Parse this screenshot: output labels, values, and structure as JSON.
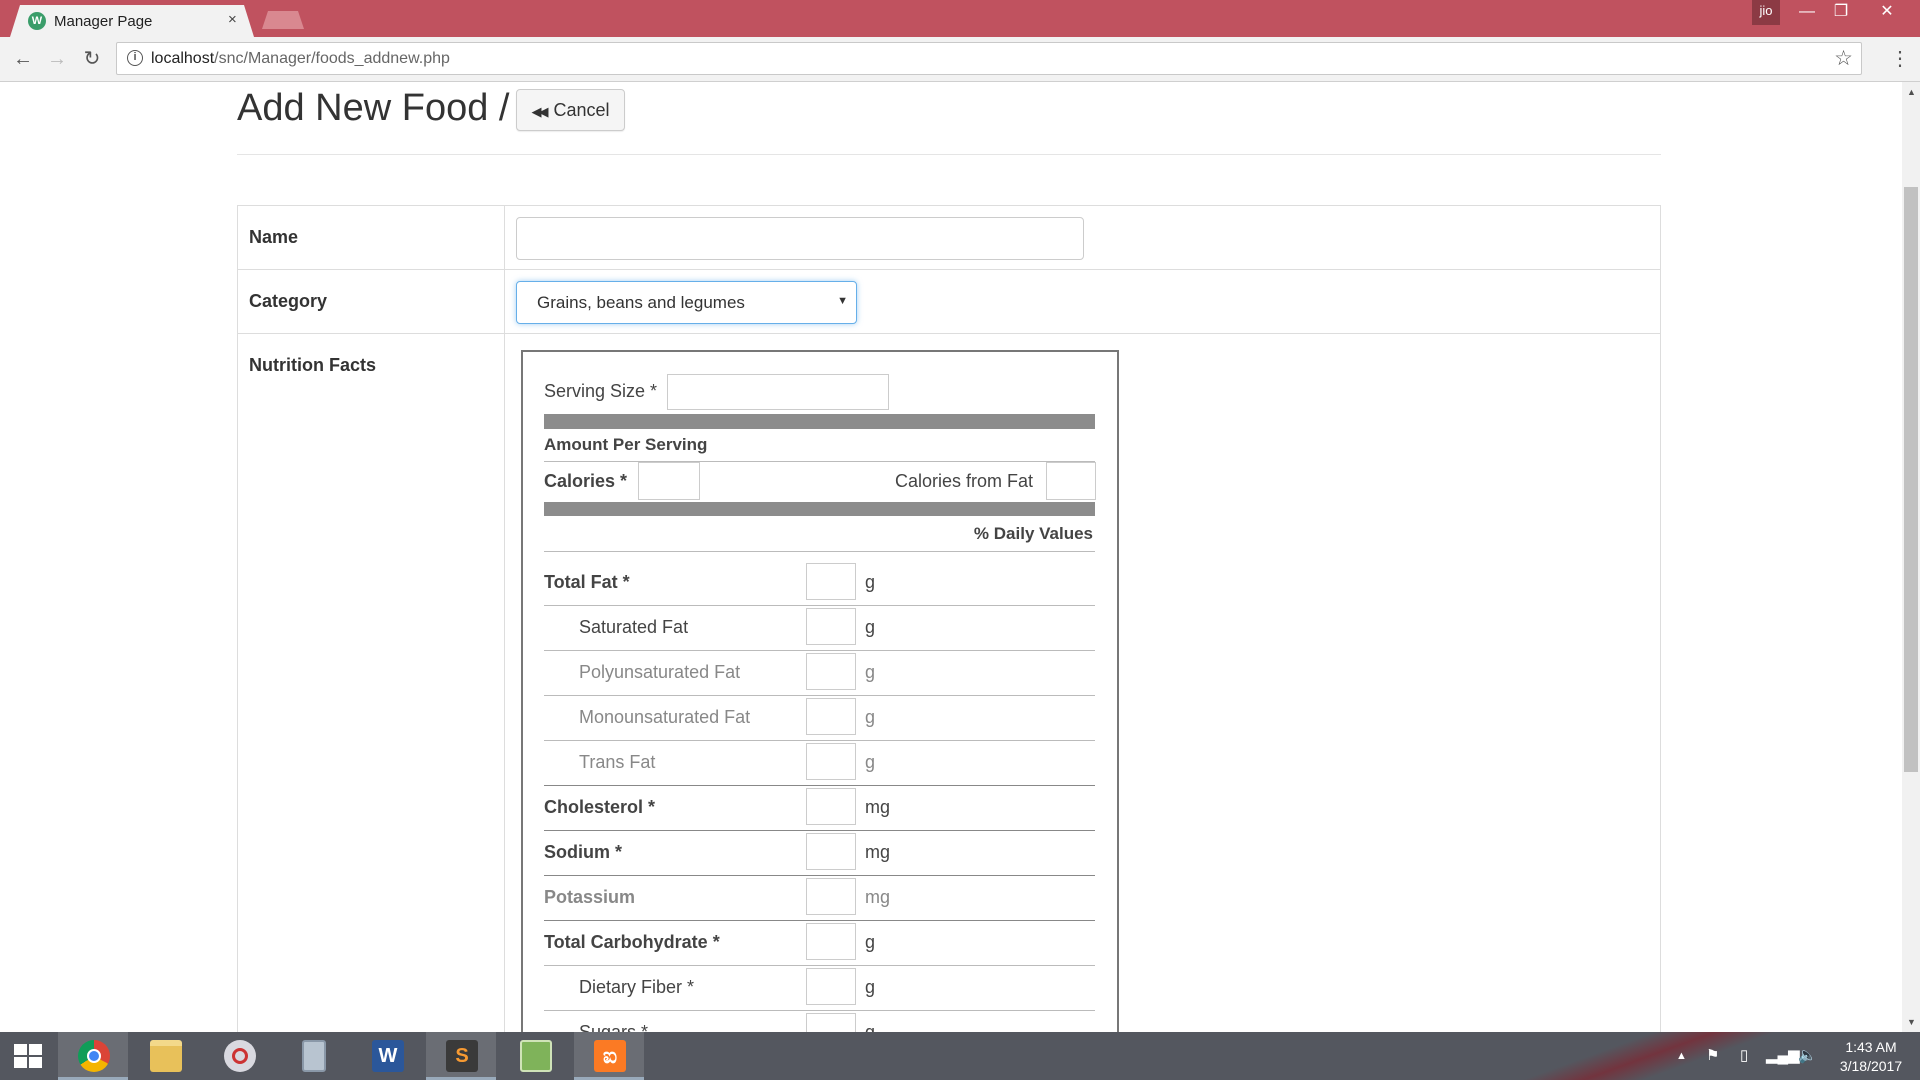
{
  "browser": {
    "tab_title": "Manager Page",
    "tab_close": "×",
    "profile_label": "jio",
    "url_host": "localhost",
    "url_path": "/snc/Manager/foods_addnew.php"
  },
  "page": {
    "title": "Add New Food /",
    "cancel_label": "Cancel",
    "rows": {
      "name_label": "Name",
      "category_label": "Category",
      "nutrition_label": "Nutrition Facts"
    },
    "category_selected": "Grains, beans and legumes"
  },
  "nutrition": {
    "serving_size": "Serving Size *",
    "amount_per_serving": "Amount Per Serving",
    "calories": "Calories *",
    "calories_from_fat": "Calories from Fat",
    "daily_values": "% Daily Values",
    "nutrients": [
      {
        "label": "Total Fat *",
        "unit": "g"
      },
      {
        "label": "Saturated Fat",
        "unit": "g"
      },
      {
        "label": "Polyunsaturated Fat",
        "unit": "g"
      },
      {
        "label": "Monounsaturated Fat",
        "unit": "g"
      },
      {
        "label": "Trans Fat",
        "unit": "g"
      },
      {
        "label": "Cholesterol *",
        "unit": "mg"
      },
      {
        "label": "Sodium *",
        "unit": "mg"
      },
      {
        "label": "Potassium",
        "unit": "mg"
      },
      {
        "label": "Total Carbohydrate *",
        "unit": "g"
      },
      {
        "label": "Dietary Fiber *",
        "unit": "g"
      },
      {
        "label": "Sugars *",
        "unit": "g"
      }
    ]
  },
  "taskbar": {
    "time": "1:43 AM",
    "date": "3/18/2017"
  },
  "colors": {
    "titlebar": "#c0525f",
    "taskbar": "#54575f",
    "focus_border": "#66afe9"
  }
}
